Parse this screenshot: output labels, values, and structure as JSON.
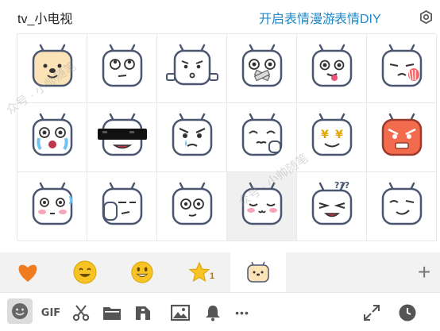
{
  "header": {
    "title": "tv_小电视",
    "roam_link": "开启表情漫游",
    "diy_link": "表情DIY"
  },
  "stickers": [
    {
      "name": "sticker-happy-dog"
    },
    {
      "name": "sticker-roll-eyes"
    },
    {
      "name": "sticker-shrug"
    },
    {
      "name": "sticker-mouth-taped"
    },
    {
      "name": "sticker-tongue-out"
    },
    {
      "name": "sticker-shy"
    },
    {
      "name": "sticker-crying"
    },
    {
      "name": "sticker-cool-sunglasses"
    },
    {
      "name": "sticker-angry-tear"
    },
    {
      "name": "sticker-thinking"
    },
    {
      "name": "sticker-money-eyes"
    },
    {
      "name": "sticker-furious"
    },
    {
      "name": "sticker-blush"
    },
    {
      "name": "sticker-facepalm"
    },
    {
      "name": "sticker-stare"
    },
    {
      "name": "sticker-content"
    },
    {
      "name": "sticker-confused"
    },
    {
      "name": "sticker-smirk"
    }
  ],
  "tabs": {
    "star_badge": "1",
    "active_index": 4
  },
  "toolbar": {
    "gif_label": "GIF",
    "more_label": "•••"
  },
  "colors": {
    "link": "#1e88c9",
    "heart": "#f07c22",
    "emoji_yellow": "#f7c325",
    "tab_bg": "#f2f2f2",
    "furious_face": "#f26b4d",
    "dog_face": "#fbe3b7"
  }
}
